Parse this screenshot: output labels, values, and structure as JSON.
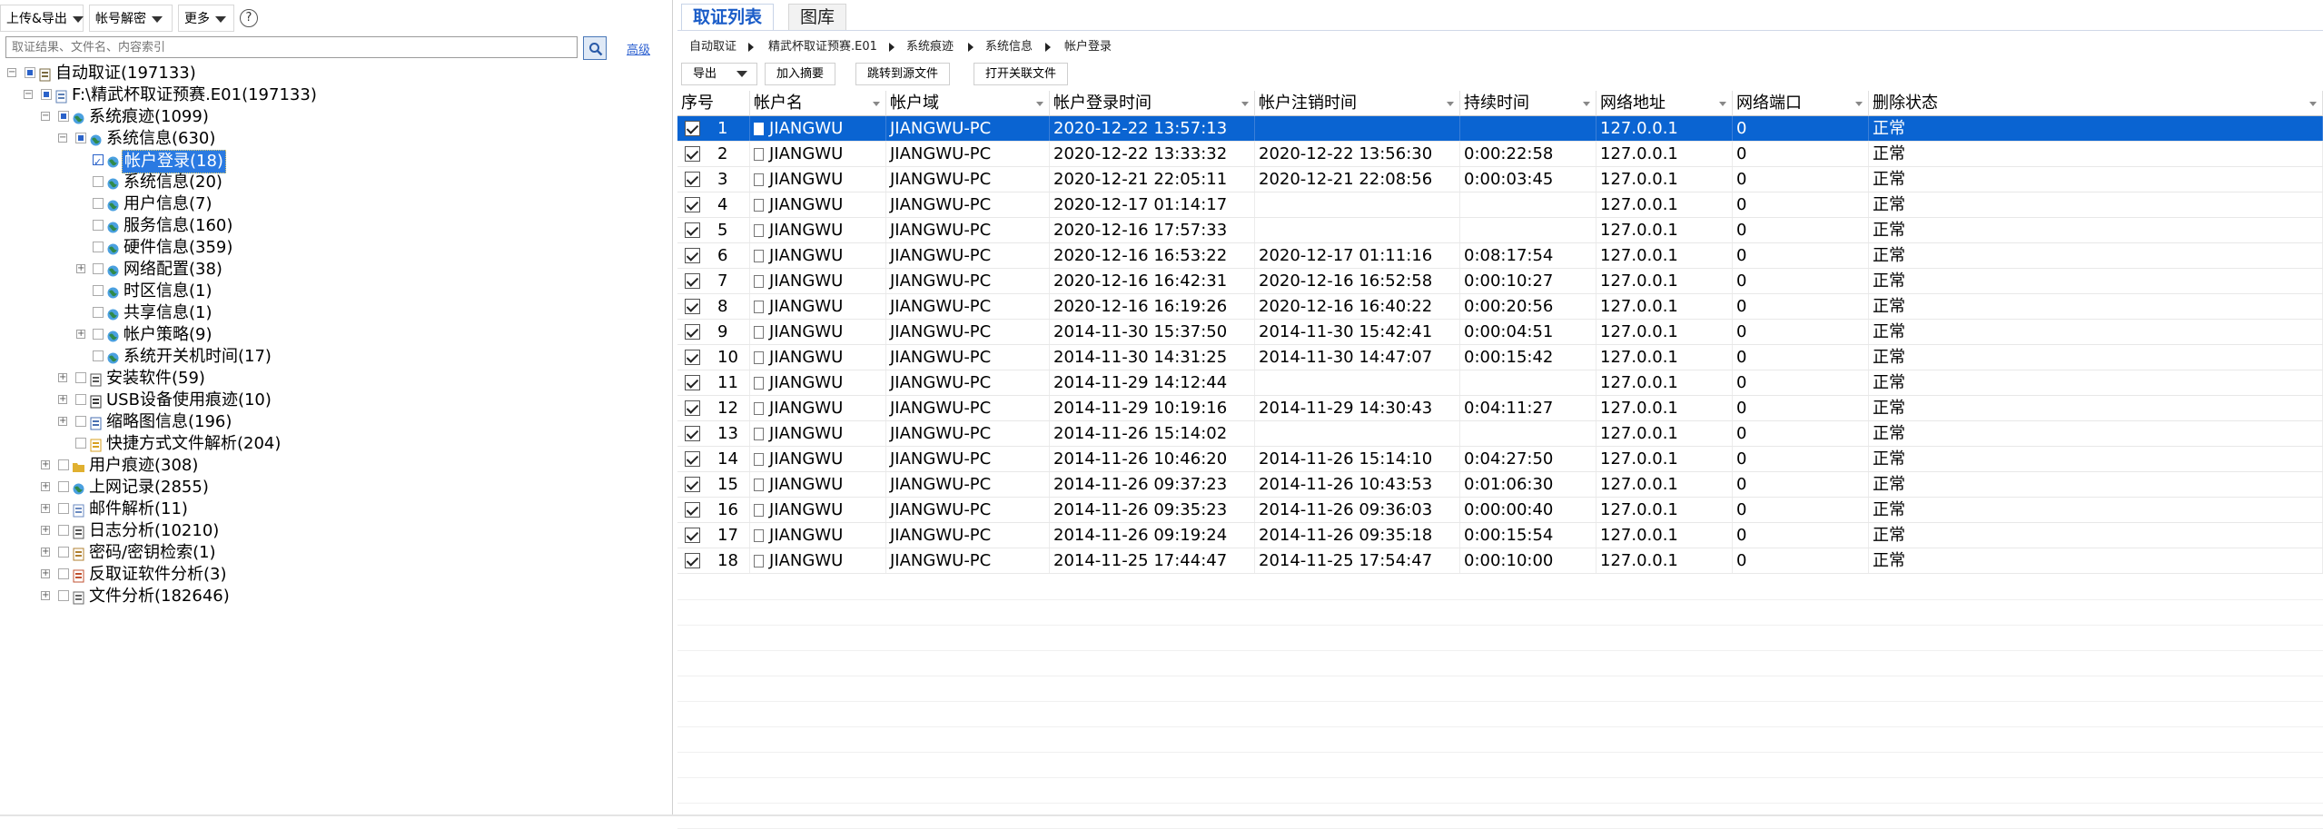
{
  "toolbar": {
    "upload_export": "上传&导出",
    "account_decrypt": "帐号解密",
    "more": "更多",
    "help": "?",
    "search_placeholder": "取证结果、文件名、内容索引",
    "advanced": "高级"
  },
  "tree": [
    {
      "label": "自动取证(197133)",
      "icon": "case-icon"
    },
    {
      "label": "F:\\精武杯取证预赛.E01(197133)",
      "icon": "disk-image-icon"
    },
    {
      "label": "系统痕迹(1099)",
      "icon": "globe-icon"
    },
    {
      "label": "系统信息(630)",
      "icon": "globe-icon"
    },
    {
      "label": "帐户登录(18)",
      "icon": "globe-icon",
      "selected": true
    },
    {
      "label": "系统信息(20)",
      "icon": "globe-icon"
    },
    {
      "label": "用户信息(7)",
      "icon": "globe-icon"
    },
    {
      "label": "服务信息(160)",
      "icon": "globe-icon"
    },
    {
      "label": "硬件信息(359)",
      "icon": "globe-icon"
    },
    {
      "label": "网络配置(38)",
      "icon": "globe-icon"
    },
    {
      "label": "时区信息(1)",
      "icon": "globe-icon"
    },
    {
      "label": "共享信息(1)",
      "icon": "globe-icon"
    },
    {
      "label": "帐户策略(9)",
      "icon": "globe-icon"
    },
    {
      "label": "系统开关机时间(17)",
      "icon": "globe-icon"
    },
    {
      "label": "安装软件(59)",
      "icon": "installer-icon"
    },
    {
      "label": "USB设备使用痕迹(10)",
      "icon": "usb-icon"
    },
    {
      "label": "缩略图信息(196)",
      "icon": "thumbnail-icon"
    },
    {
      "label": "快捷方式文件解析(204)",
      "icon": "shortcut-icon"
    },
    {
      "label": "用户痕迹(308)",
      "icon": "folder-icon"
    },
    {
      "label": "上网记录(2855)",
      "icon": "globe-icon"
    },
    {
      "label": "邮件解析(11)",
      "icon": "mail-icon"
    },
    {
      "label": "日志分析(10210)",
      "icon": "log-icon"
    },
    {
      "label": "密码/密钥检索(1)",
      "icon": "key-icon"
    },
    {
      "label": "反取证软件分析(3)",
      "icon": "anti-forensics-icon"
    },
    {
      "label": "文件分析(182646)",
      "icon": "file-analysis-icon"
    }
  ],
  "tabs": [
    "取证列表",
    "图库"
  ],
  "breadcrumb": [
    "自动取证",
    "精武杯取证预赛.E01",
    "系统痕迹",
    "系统信息",
    "帐户登录"
  ],
  "actions": {
    "export": "导出",
    "add_summary": "加入摘要",
    "jump_to_source": "跳转到源文件",
    "open_related": "打开关联文件"
  },
  "table": {
    "columns": [
      "序号",
      "帐户名",
      "帐户域",
      "帐户登录时间",
      "帐户注销时间",
      "持续时间",
      "网络地址",
      "网络端口",
      "删除状态"
    ],
    "rows": [
      [
        "1",
        "JIANGWU",
        "JIANGWU-PC",
        "2020-12-22 13:57:13",
        "",
        "",
        "127.0.0.1",
        "0",
        "正常"
      ],
      [
        "2",
        "JIANGWU",
        "JIANGWU-PC",
        "2020-12-22 13:33:32",
        "2020-12-22 13:56:30",
        "0:00:22:58",
        "127.0.0.1",
        "0",
        "正常"
      ],
      [
        "3",
        "JIANGWU",
        "JIANGWU-PC",
        "2020-12-21 22:05:11",
        "2020-12-21 22:08:56",
        "0:00:03:45",
        "127.0.0.1",
        "0",
        "正常"
      ],
      [
        "4",
        "JIANGWU",
        "JIANGWU-PC",
        "2020-12-17 01:14:17",
        "",
        "",
        "127.0.0.1",
        "0",
        "正常"
      ],
      [
        "5",
        "JIANGWU",
        "JIANGWU-PC",
        "2020-12-16 17:57:33",
        "",
        "",
        "127.0.0.1",
        "0",
        "正常"
      ],
      [
        "6",
        "JIANGWU",
        "JIANGWU-PC",
        "2020-12-16 16:53:22",
        "2020-12-17 01:11:16",
        "0:08:17:54",
        "127.0.0.1",
        "0",
        "正常"
      ],
      [
        "7",
        "JIANGWU",
        "JIANGWU-PC",
        "2020-12-16 16:42:31",
        "2020-12-16 16:52:58",
        "0:00:10:27",
        "127.0.0.1",
        "0",
        "正常"
      ],
      [
        "8",
        "JIANGWU",
        "JIANGWU-PC",
        "2020-12-16 16:19:26",
        "2020-12-16 16:40:22",
        "0:00:20:56",
        "127.0.0.1",
        "0",
        "正常"
      ],
      [
        "9",
        "JIANGWU",
        "JIANGWU-PC",
        "2014-11-30 15:37:50",
        "2014-11-30 15:42:41",
        "0:00:04:51",
        "127.0.0.1",
        "0",
        "正常"
      ],
      [
        "10",
        "JIANGWU",
        "JIANGWU-PC",
        "2014-11-30 14:31:25",
        "2014-11-30 14:47:07",
        "0:00:15:42",
        "127.0.0.1",
        "0",
        "正常"
      ],
      [
        "11",
        "JIANGWU",
        "JIANGWU-PC",
        "2014-11-29 14:12:44",
        "",
        "",
        "127.0.0.1",
        "0",
        "正常"
      ],
      [
        "12",
        "JIANGWU",
        "JIANGWU-PC",
        "2014-11-29 10:19:16",
        "2014-11-29 14:30:43",
        "0:04:11:27",
        "127.0.0.1",
        "0",
        "正常"
      ],
      [
        "13",
        "JIANGWU",
        "JIANGWU-PC",
        "2014-11-26 15:14:02",
        "",
        "",
        "127.0.0.1",
        "0",
        "正常"
      ],
      [
        "14",
        "JIANGWU",
        "JIANGWU-PC",
        "2014-11-26 10:46:20",
        "2014-11-26 15:14:10",
        "0:04:27:50",
        "127.0.0.1",
        "0",
        "正常"
      ],
      [
        "15",
        "JIANGWU",
        "JIANGWU-PC",
        "2014-11-26 09:37:23",
        "2014-11-26 10:43:53",
        "0:01:06:30",
        "127.0.0.1",
        "0",
        "正常"
      ],
      [
        "16",
        "JIANGWU",
        "JIANGWU-PC",
        "2014-11-26 09:35:23",
        "2014-11-26 09:36:03",
        "0:00:00:40",
        "127.0.0.1",
        "0",
        "正常"
      ],
      [
        "17",
        "JIANGWU",
        "JIANGWU-PC",
        "2014-11-26 09:19:24",
        "2014-11-26 09:35:18",
        "0:00:15:54",
        "127.0.0.1",
        "0",
        "正常"
      ],
      [
        "18",
        "JIANGWU",
        "JIANGWU-PC",
        "2014-11-25 17:44:47",
        "2014-11-25 17:54:47",
        "0:00:10:00",
        "127.0.0.1",
        "0",
        "正常"
      ]
    ],
    "selected_row": 1
  },
  "colors": {
    "accent": "#0a64d2",
    "tab_active": "#1a5cc8",
    "link": "#2b5fd0"
  }
}
